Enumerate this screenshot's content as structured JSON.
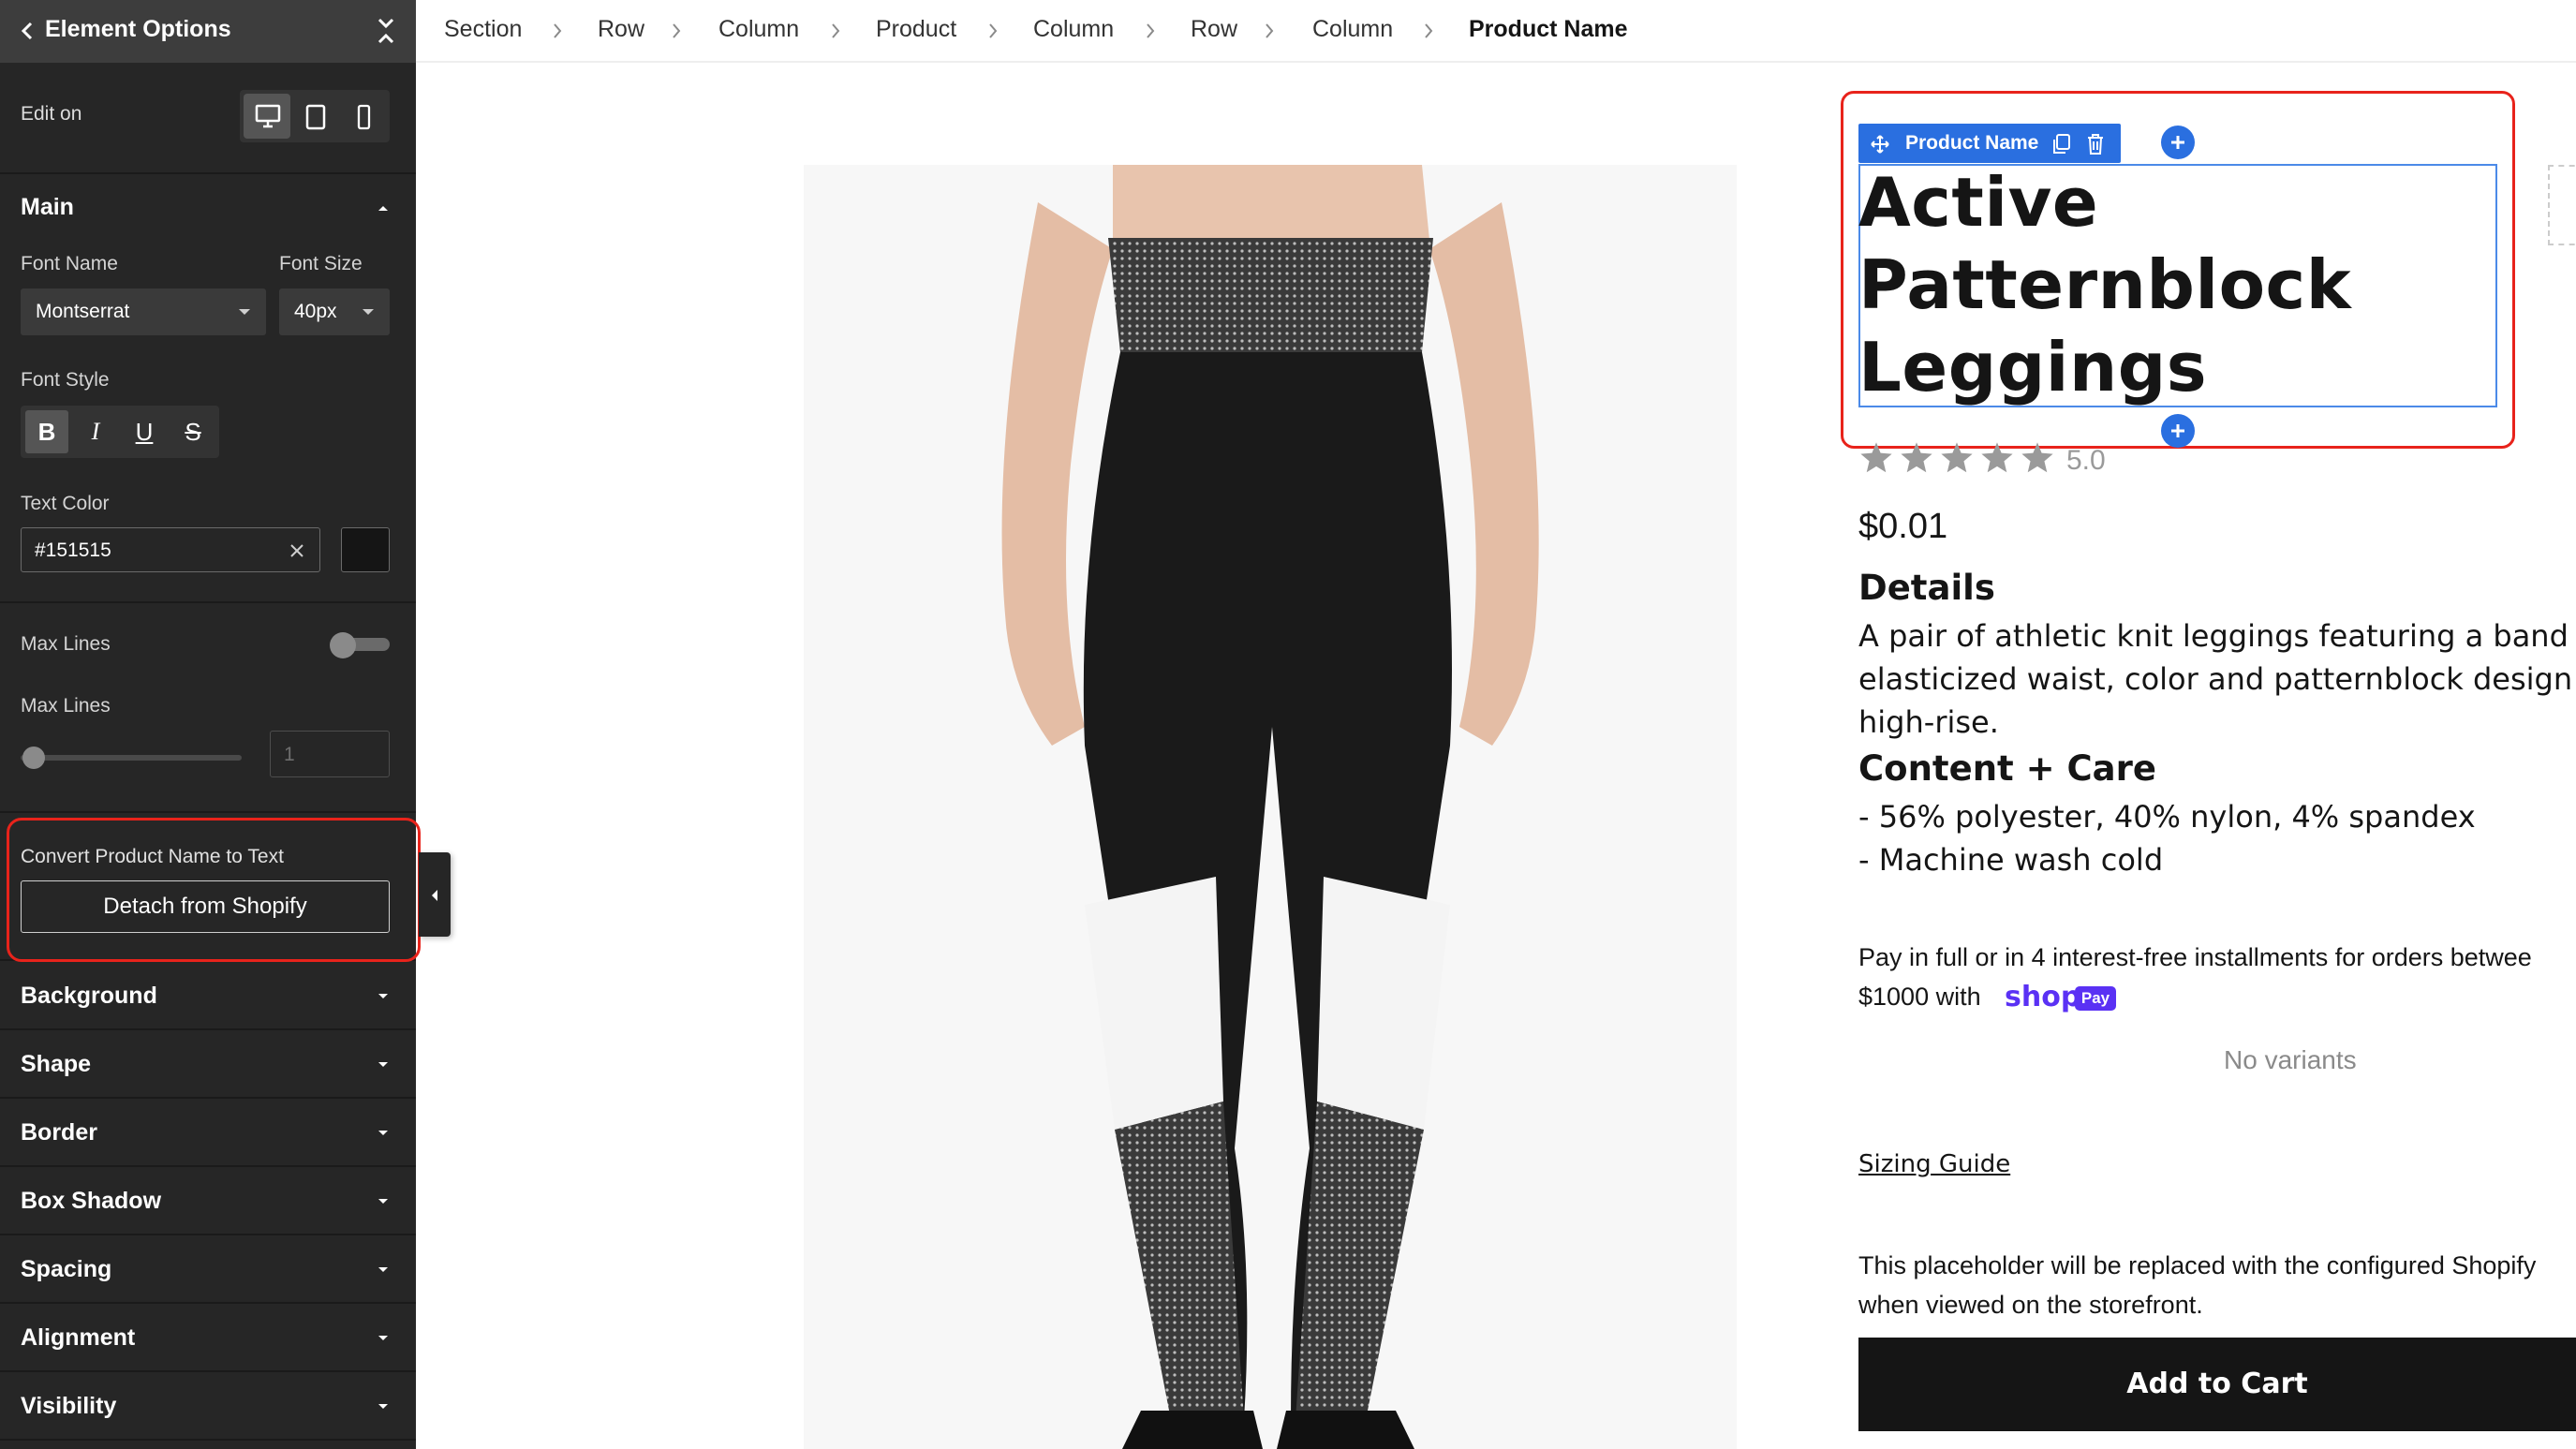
{
  "panel": {
    "title": "Element Options",
    "edit_on_label": "Edit on",
    "devices": [
      "desktop",
      "tablet",
      "mobile"
    ],
    "main_section": "Main",
    "font_name_label": "Font Name",
    "font_name_value": "Montserrat",
    "font_size_label": "Font Size",
    "font_size_value": "40px",
    "font_style_label": "Font Style",
    "style_buttons": [
      "B",
      "I",
      "U",
      "S"
    ],
    "text_color_label": "Text Color",
    "text_color_value": "#151515",
    "max_lines_toggle_label": "Max Lines",
    "max_lines_slider_label": "Max Lines",
    "max_lines_value": "1",
    "convert_label": "Convert Product Name to Text",
    "detach_button": "Detach from Shopify",
    "sections": [
      "Background",
      "Shape",
      "Border",
      "Box Shadow",
      "Spacing",
      "Alignment",
      "Visibility"
    ],
    "accent_color": "#262626"
  },
  "breadcrumb": {
    "items": [
      "Section",
      "Row",
      "Column",
      "Product",
      "Column",
      "Row",
      "Column",
      "Product Name"
    ]
  },
  "canvas": {
    "element_toolbar_name": "Product Name",
    "product_title_lines": [
      "Active",
      "Patternblock",
      "Leggings"
    ],
    "rating": "5.0",
    "stars": 5,
    "price": "$0.01",
    "details_heading": "Details",
    "details_lines": [
      "A pair of athletic knit leggings featuring a band",
      "elasticized waist, color and patternblock design",
      "high-rise."
    ],
    "care_heading": "Content + Care",
    "care_lines": [
      "- 56% polyester, 40% nylon, 4% spandex",
      "- Machine wash cold"
    ],
    "pay_line1": "Pay in full or in 4 interest-free installments for orders betwee",
    "pay_line2": "$1000 with",
    "shop_logo": "shop",
    "shop_pay_badge": "Pay",
    "no_variants": "No variants",
    "sizing_guide": "Sizing Guide",
    "placeholder_line1": "This placeholder will be replaced with the configured Shopify",
    "placeholder_line2": "when viewed on the storefront.",
    "add_to_cart": "Add to Cart",
    "selection_color": "#2a6fe0",
    "highlight_color": "#e8231b",
    "shop_pay_color": "#5a31f4"
  }
}
